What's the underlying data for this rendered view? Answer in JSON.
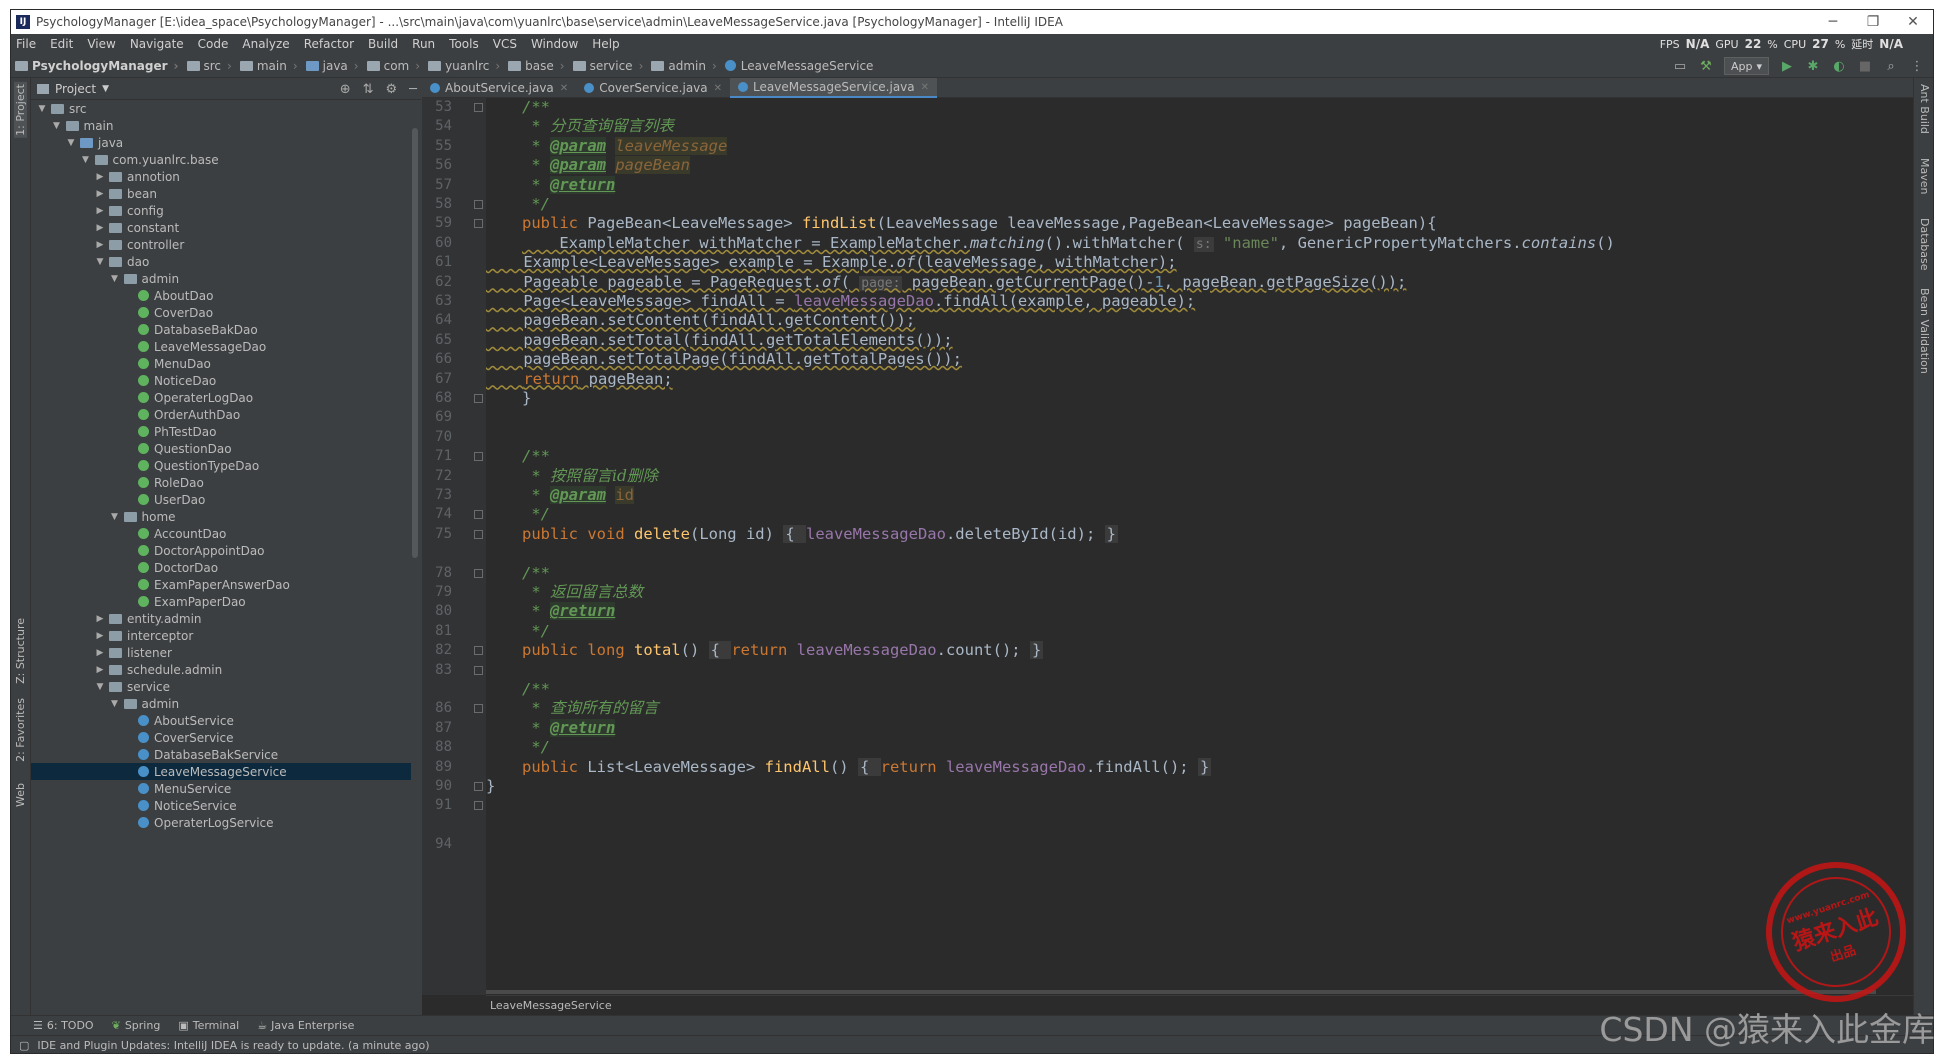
{
  "window": {
    "title": "PsychologyManager [E:\\idea_space\\PsychologyManager] - ...\\src\\main\\java\\com\\yuanlrc\\base\\service\\admin\\LeaveMessageService.java [PsychologyManager] - IntelliJ IDEA",
    "icon": "intellij-icon",
    "minimize": "─",
    "restore": "❐",
    "close": "✕"
  },
  "menu": [
    "File",
    "Edit",
    "View",
    "Navigate",
    "Code",
    "Analyze",
    "Refactor",
    "Build",
    "Run",
    "Tools",
    "VCS",
    "Window",
    "Help"
  ],
  "perf": {
    "fps_label": "FPS",
    "fps_value": "N/A",
    "gpu_label": "GPU",
    "gpu_value": "22",
    "cpu_label": "CPU",
    "cpu_value": "27",
    "latency_label": "延时",
    "latency_value": "N/A",
    "percent": "%"
  },
  "breadcrumbs": [
    "PsychologyManager",
    "src",
    "main",
    "java",
    "com",
    "yuanlrc",
    "base",
    "service",
    "admin",
    "LeaveMessageService"
  ],
  "run_config": "App",
  "left_stripe": {
    "project": "1: Project",
    "structure": "Z: Structure",
    "favorites": "2: Favorites",
    "web": "Web"
  },
  "right_stripe": {
    "ant": "Ant Build",
    "maven": "Maven",
    "database": "Database",
    "bean": "Bean Validation"
  },
  "project_panel": {
    "title": "Project"
  },
  "tree": [
    {
      "label": "src",
      "depth": 1,
      "kind": "folder",
      "open": true
    },
    {
      "label": "main",
      "depth": 2,
      "kind": "folder",
      "open": true
    },
    {
      "label": "java",
      "depth": 3,
      "kind": "folder-blue",
      "open": true
    },
    {
      "label": "com.yuanlrc.base",
      "depth": 4,
      "kind": "folder",
      "open": true
    },
    {
      "label": "annotion",
      "depth": 5,
      "kind": "folder",
      "open": false
    },
    {
      "label": "bean",
      "depth": 5,
      "kind": "folder",
      "open": false
    },
    {
      "label": "config",
      "depth": 5,
      "kind": "folder",
      "open": false
    },
    {
      "label": "constant",
      "depth": 5,
      "kind": "folder",
      "open": false
    },
    {
      "label": "controller",
      "depth": 5,
      "kind": "folder",
      "open": false
    },
    {
      "label": "dao",
      "depth": 5,
      "kind": "folder",
      "open": true
    },
    {
      "label": "admin",
      "depth": 6,
      "kind": "folder",
      "open": true
    },
    {
      "label": "AboutDao",
      "depth": 7,
      "kind": "interface"
    },
    {
      "label": "CoverDao",
      "depth": 7,
      "kind": "interface"
    },
    {
      "label": "DatabaseBakDao",
      "depth": 7,
      "kind": "interface"
    },
    {
      "label": "LeaveMessageDao",
      "depth": 7,
      "kind": "interface"
    },
    {
      "label": "MenuDao",
      "depth": 7,
      "kind": "interface"
    },
    {
      "label": "NoticeDao",
      "depth": 7,
      "kind": "interface"
    },
    {
      "label": "OperaterLogDao",
      "depth": 7,
      "kind": "interface"
    },
    {
      "label": "OrderAuthDao",
      "depth": 7,
      "kind": "interface"
    },
    {
      "label": "PhTestDao",
      "depth": 7,
      "kind": "interface"
    },
    {
      "label": "QuestionDao",
      "depth": 7,
      "kind": "interface"
    },
    {
      "label": "QuestionTypeDao",
      "depth": 7,
      "kind": "interface"
    },
    {
      "label": "RoleDao",
      "depth": 7,
      "kind": "interface"
    },
    {
      "label": "UserDao",
      "depth": 7,
      "kind": "interface"
    },
    {
      "label": "home",
      "depth": 6,
      "kind": "folder",
      "open": true
    },
    {
      "label": "AccountDao",
      "depth": 7,
      "kind": "interface"
    },
    {
      "label": "DoctorAppointDao",
      "depth": 7,
      "kind": "interface"
    },
    {
      "label": "DoctorDao",
      "depth": 7,
      "kind": "interface"
    },
    {
      "label": "ExamPaperAnswerDao",
      "depth": 7,
      "kind": "interface"
    },
    {
      "label": "ExamPaperDao",
      "depth": 7,
      "kind": "interface"
    },
    {
      "label": "entity.admin",
      "depth": 5,
      "kind": "folder",
      "open": false
    },
    {
      "label": "interceptor",
      "depth": 5,
      "kind": "folder",
      "open": false
    },
    {
      "label": "listener",
      "depth": 5,
      "kind": "folder",
      "open": false
    },
    {
      "label": "schedule.admin",
      "depth": 5,
      "kind": "folder",
      "open": false
    },
    {
      "label": "service",
      "depth": 5,
      "kind": "folder",
      "open": true
    },
    {
      "label": "admin",
      "depth": 6,
      "kind": "folder",
      "open": true
    },
    {
      "label": "AboutService",
      "depth": 7,
      "kind": "class"
    },
    {
      "label": "CoverService",
      "depth": 7,
      "kind": "class"
    },
    {
      "label": "DatabaseBakService",
      "depth": 7,
      "kind": "class"
    },
    {
      "label": "LeaveMessageService",
      "depth": 7,
      "kind": "class",
      "selected": true
    },
    {
      "label": "MenuService",
      "depth": 7,
      "kind": "class"
    },
    {
      "label": "NoticeService",
      "depth": 7,
      "kind": "class"
    },
    {
      "label": "OperaterLogService",
      "depth": 7,
      "kind": "class"
    }
  ],
  "tabs": [
    {
      "label": "AboutService.java",
      "active": false
    },
    {
      "label": "CoverService.java",
      "active": false
    },
    {
      "label": "LeaveMessageService.java",
      "active": true
    }
  ],
  "line_numbers": [
    "53",
    "54",
    "55",
    "56",
    "57",
    "58",
    "59",
    "60",
    "61",
    "62",
    "63",
    "64",
    "65",
    "66",
    "67",
    "68",
    "69",
    "70",
    "71",
    "72",
    "73",
    "74",
    "75",
    "78",
    "79",
    "80",
    "81",
    "82",
    "83",
    "86",
    "87",
    "88",
    "89",
    "90",
    "91",
    "94"
  ],
  "code": {
    "l53": "/**",
    "l54_star": " * ",
    "l54_text": "分页查询留言列表",
    "l55_star": " * ",
    "l55_tag": "@param",
    "l55_param": "leaveMessage",
    "l56_star": " * ",
    "l56_tag": "@param",
    "l56_param": "pageBean",
    "l57_star": " * ",
    "l57_tag": "@return",
    "l58": " */",
    "l59": [
      "public ",
      "PageBean<LeaveMessage> ",
      "findList",
      "(LeaveMessage leaveMessage,PageBean<LeaveMessage> pageBean){"
    ],
    "l60": [
      "    ExampleMatcher withMatcher = ExampleMatcher.",
      "matching",
      "().withMatcher( ",
      "s:",
      " ",
      "\"name\"",
      ", GenericPropertyMatchers.",
      "contains",
      "()"
    ],
    "l61": [
      "    Example<LeaveMessage> example = Example.",
      "of",
      "(leaveMessage, withMatcher);"
    ],
    "l62": [
      "    Pageable pageable = PageRequest.",
      "of",
      "( ",
      "page:",
      " pageBean.getCurrentPage()-",
      "1",
      ", pageBean.getPageSize());"
    ],
    "l63": [
      "    Page<LeaveMessage> findAll = ",
      "leaveMessageDao",
      ".findAll(example, pageable);"
    ],
    "l64": "    pageBean.setContent(findAll.getContent());",
    "l65": "    pageBean.setTotal(findAll.getTotalElements());",
    "l66": "    pageBean.setTotalPage(findAll.getTotalPages());",
    "l67": [
      "    ",
      "return",
      " pageBean;"
    ],
    "l68": "}",
    "l71": "/**",
    "l72_star": " * ",
    "l72_text": "按照留言id删除",
    "l73_star": " * ",
    "l73_tag": "@param",
    "l73_param": "id",
    "l74": " */",
    "l75": [
      "public void ",
      "delete",
      "(Long id) ",
      "{ ",
      "leaveMessageDao",
      ".deleteById(id); ",
      "}"
    ],
    "l79": "/**",
    "l80_star": " * ",
    "l80_text": "返回留言总数",
    "l81_star": " * ",
    "l81_tag": "@return",
    "l82": " */",
    "l83": [
      "public long ",
      "total",
      "() ",
      "{ ",
      "return ",
      "leaveMessageDao",
      ".count(); ",
      "}"
    ],
    "l87": "/**",
    "l88_star": " * ",
    "l88_text": "查询所有的留言",
    "l89_star": " * ",
    "l89_tag": "@return",
    "l90": " */",
    "l91": [
      "public ",
      "List<LeaveMessage> ",
      "findAll",
      "() ",
      "{ ",
      "return ",
      "leaveMessageDao",
      ".findAll(); ",
      "}"
    ],
    "l94": "}"
  },
  "editor_breadcrumb": "LeaveMessageService",
  "bottom_tools": [
    {
      "label": "6: TODO",
      "icon": "todo-icon"
    },
    {
      "label": "Spring",
      "icon": "spring-icon"
    },
    {
      "label": "Terminal",
      "icon": "terminal-icon"
    },
    {
      "label": "Java Enterprise",
      "icon": "java-enterprise-icon"
    }
  ],
  "status": "IDE and Plugin Updates: IntelliJ IDEA is ready to update. (a minute ago)",
  "watermark": "CSDN @猿来入此金库",
  "seal": {
    "main": "猿来入此",
    "sub": "出品",
    "url": "www.yuanrc.com"
  },
  "colors": {
    "keyword": "#cc7832",
    "function": "#ffc66d",
    "comment": "#629755",
    "field": "#9876aa",
    "string": "#6a8759",
    "selection": "#0d293e"
  }
}
